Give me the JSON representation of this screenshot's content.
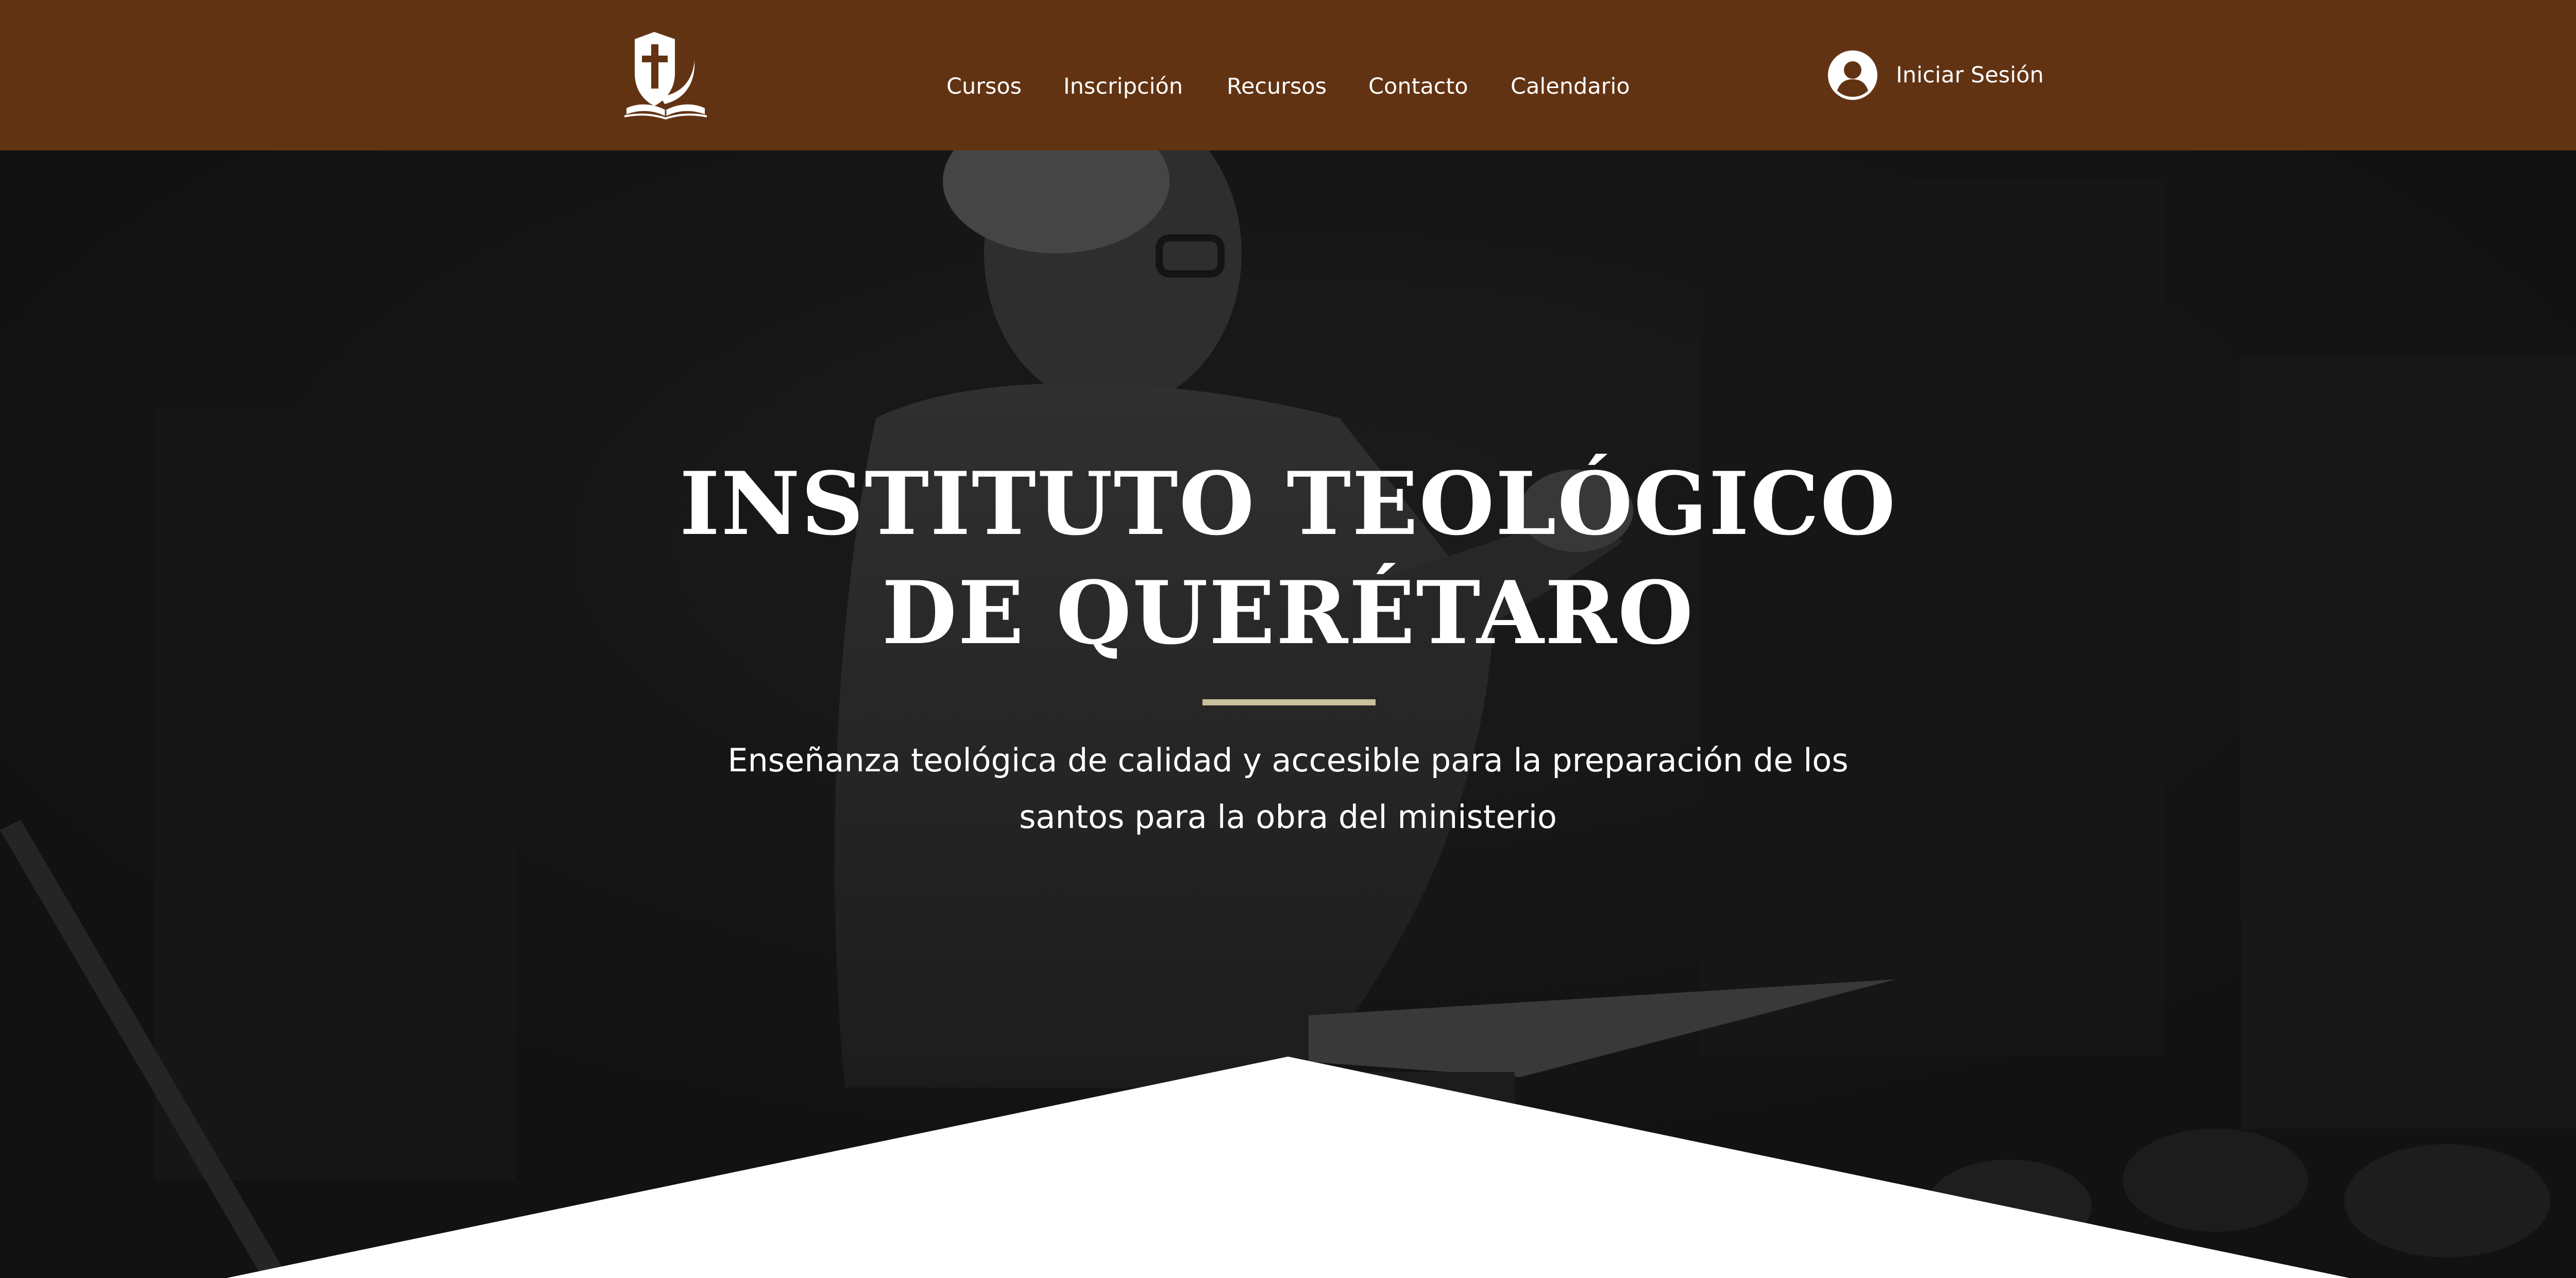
{
  "header": {
    "background": "#623313",
    "logo_icon": "shield-cross-bible-logo",
    "nav": [
      {
        "label": "Cursos"
      },
      {
        "label": "Inscripción"
      },
      {
        "label": "Recursos"
      },
      {
        "label": "Contacto"
      },
      {
        "label": "Calendario"
      }
    ],
    "login": {
      "icon": "user-avatar-icon",
      "label": "Iniciar Sesión"
    }
  },
  "hero": {
    "title_line1": "INSTITUTO TEOLÓGICO",
    "title_line2": "DE QUERÉTARO",
    "subtitle_line1": "Enseñanza teológica de calidad y accesible para la preparación de los",
    "subtitle_line2": "santos para la obra del ministerio",
    "accent_rule_color": "#c9c19a",
    "background_image": "preacher-at-podium-photo"
  }
}
